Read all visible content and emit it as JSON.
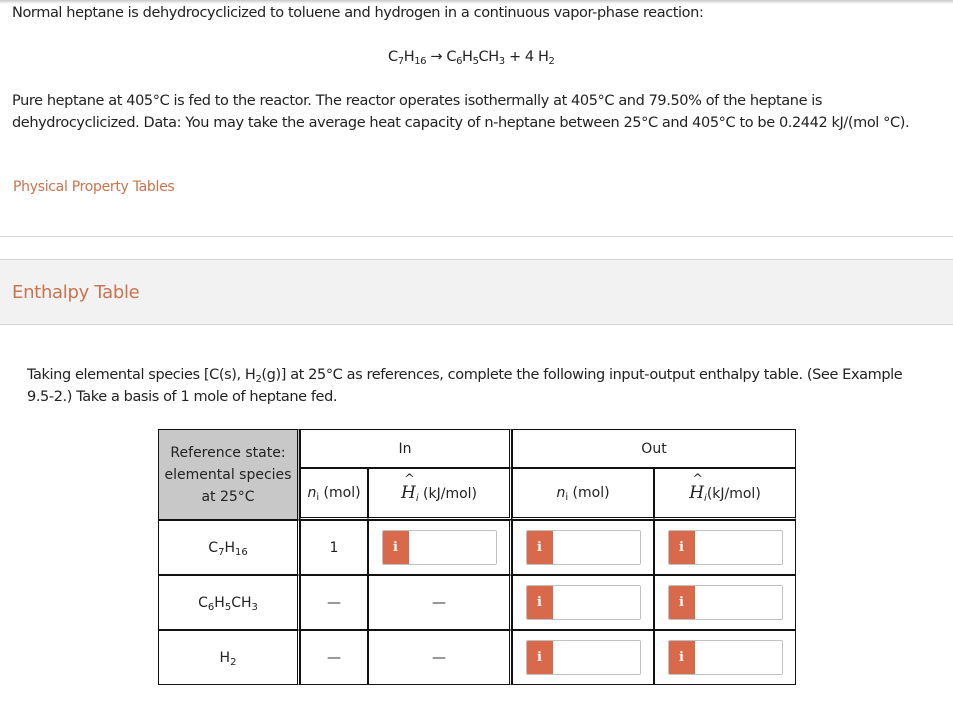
{
  "problem": {
    "intro": "Normal heptane is dehydrocyclicized to toluene and hydrogen in a continuous vapor-phase reaction:",
    "equation": {
      "reactant": {
        "c": "C",
        "c_sub": "7",
        "h": "H",
        "h_sub": "16"
      },
      "arrow": "→",
      "product1": {
        "a": "C",
        "a_sub": "6",
        "b": "H",
        "b_sub": "5",
        "c": "CH",
        "c_sub": "3"
      },
      "plus": "+ 4 H",
      "plus_sub": "2"
    },
    "paragraph": "Pure heptane at 405°C is fed to the reactor. The reactor operates isothermally at 405°C and 79.50% of the heptane is dehydrocyclicized. Data: You may take the average heat capacity of n-heptane between 25°C and 405°C to be 0.2442 kJ/(mol °C)."
  },
  "links": {
    "physical_property_tables": "Physical Property Tables"
  },
  "section": {
    "title": "Enthalpy Table",
    "instructions_part1": "Taking elemental species [C(s), H",
    "instructions_sub": "2",
    "instructions_part2": "(g)] at 25°C as references, complete the following input-output enthalpy table. (See Example 9.5-2.) Take a basis of 1 mole of heptane fed."
  },
  "table": {
    "reference_header": [
      "Reference state:",
      "elemental species",
      "at 25°C"
    ],
    "in_label": "In",
    "out_label": "Out",
    "n_label": "n",
    "n_sub": "i",
    "n_unit": " (mol)",
    "h_label": "H",
    "h_sub": "i",
    "h_unit_in": " (kJ/mol)",
    "h_unit_out": "(kJ/mol)",
    "input_icon_label": "i",
    "dash": "—",
    "rows": [
      {
        "species": {
          "p1": "C",
          "s1": "7",
          "p2": "H",
          "s2": "16",
          "p3": "",
          "s3": ""
        },
        "n_in": "1",
        "h_in": "",
        "n_out": "",
        "h_out": ""
      },
      {
        "species": {
          "p1": "C",
          "s1": "6",
          "p2": "H",
          "s2": "5",
          "p3": "CH",
          "s3": "3"
        },
        "n_in": "—",
        "h_in": "—",
        "n_out": "",
        "h_out": ""
      },
      {
        "species": {
          "p1": "H",
          "s1": "2",
          "p2": "",
          "s2": "",
          "p3": "",
          "s3": ""
        },
        "n_in": "—",
        "h_in": "—",
        "n_out": "",
        "h_out": ""
      }
    ]
  },
  "colors": {
    "accent": "#c9734f",
    "input_icon": "#d9694b",
    "reference_bg": "#c8c8c8",
    "section_bg": "#f2f2f2"
  }
}
